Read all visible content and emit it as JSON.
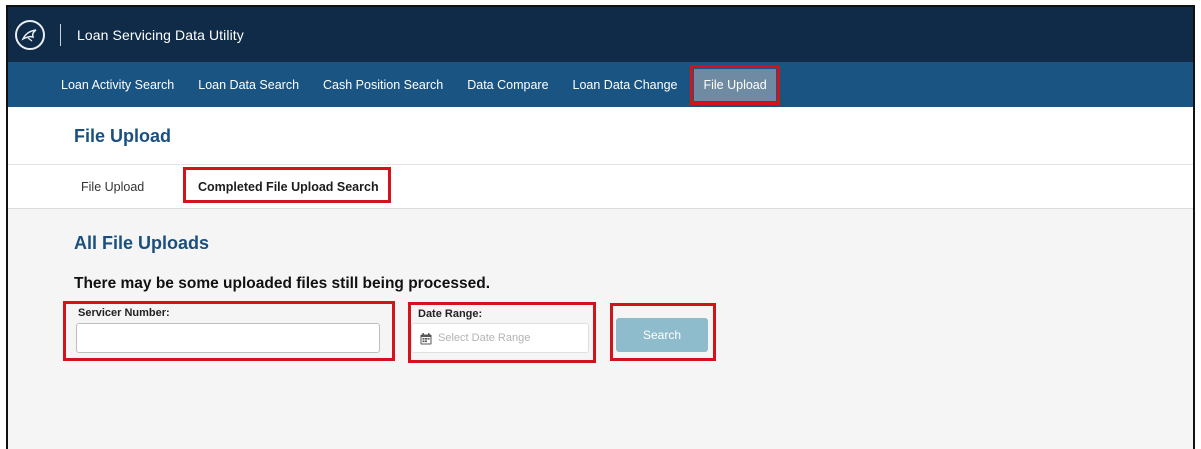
{
  "app": {
    "title": "Loan Servicing Data Utility",
    "logo_icon": "eagle-seal-icon"
  },
  "nav": {
    "items": [
      {
        "label": "Loan Activity Search"
      },
      {
        "label": "Loan Data Search"
      },
      {
        "label": "Cash Position Search"
      },
      {
        "label": "Data Compare"
      },
      {
        "label": "Loan Data Change"
      },
      {
        "label": "File Upload",
        "active": true
      }
    ]
  },
  "page": {
    "title": "File Upload"
  },
  "tabs": [
    {
      "label": "File Upload"
    },
    {
      "label": "Completed File Upload Search",
      "active": true
    }
  ],
  "content": {
    "section_title": "All File Uploads",
    "notice": "There may be some uploaded files still being processed.",
    "servicer": {
      "label": "Servicer Number:",
      "value": "",
      "placeholder": ""
    },
    "date_range": {
      "label": "Date Range:",
      "placeholder": "Select Date Range",
      "icon": "calendar-icon"
    },
    "search_button": "Search"
  },
  "colors": {
    "top_bar": "#0f2b47",
    "nav_bar": "#1a5482",
    "nav_active": "#6f8aa3",
    "heading": "#1a4f7e",
    "search_button": "#8fbccd",
    "highlight": "#d3131a"
  }
}
